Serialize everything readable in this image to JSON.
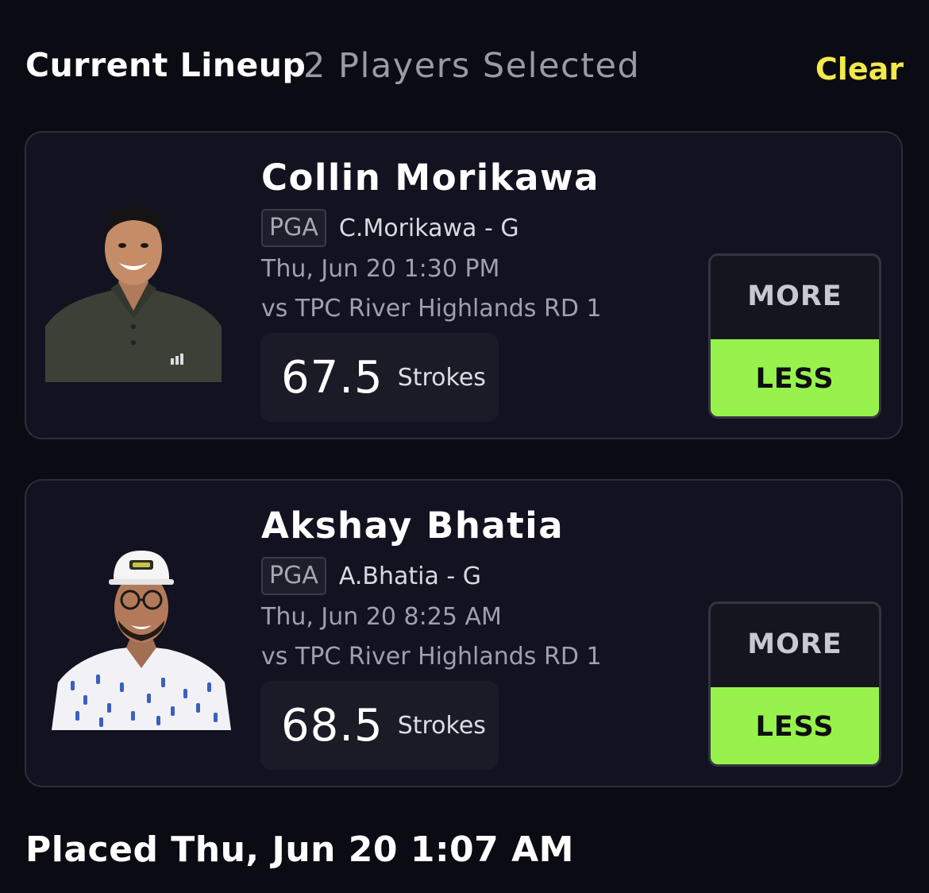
{
  "header": {
    "title": "Current Lineup",
    "subtitle": "2 Players Selected",
    "clear_label": "Clear"
  },
  "players": [
    {
      "name": "Collin Morikawa",
      "league": "PGA",
      "short_name": "C.Morikawa - G",
      "time": "Thu, Jun 20 1:30 PM",
      "venue": "vs TPC River Highlands RD 1",
      "line_value": "67.5",
      "line_unit": "Strokes",
      "more_label": "MORE",
      "less_label": "LESS",
      "selected": "LESS"
    },
    {
      "name": "Akshay Bhatia",
      "league": "PGA",
      "short_name": "A.Bhatia - G",
      "time": "Thu, Jun 20 8:25 AM",
      "venue": "vs TPC River Highlands RD 1",
      "line_value": "68.5",
      "line_unit": "Strokes",
      "more_label": "MORE",
      "less_label": "LESS",
      "selected": "LESS"
    }
  ],
  "placed": "Placed Thu, Jun 20 1:07 AM",
  "colors": {
    "background": "#0b0b14",
    "card": "#121220",
    "accent_yellow": "#f3e94a",
    "less_green": "#97f24c"
  }
}
